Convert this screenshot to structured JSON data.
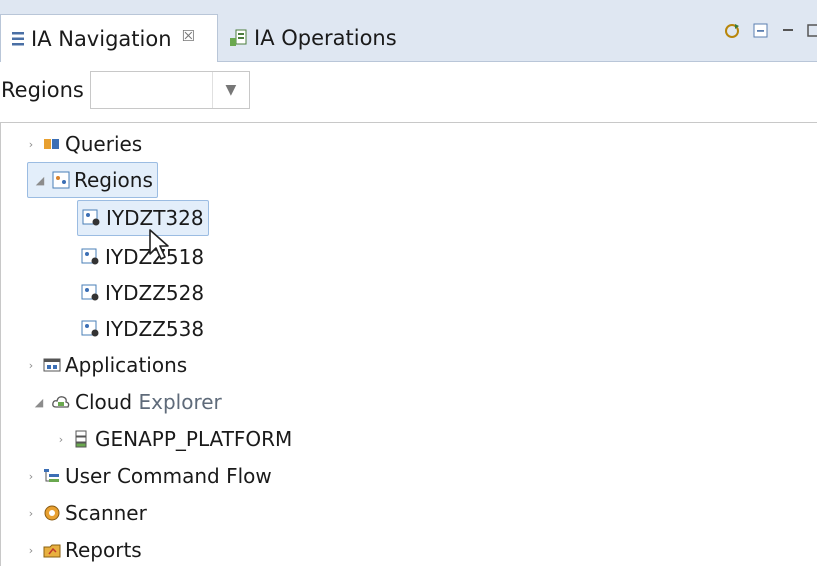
{
  "tabs": [
    {
      "label": "IA Navigation",
      "close": "☒",
      "icon": "navigation-list-icon"
    },
    {
      "label": "IA Operations",
      "icon": "operations-icon"
    }
  ],
  "filter": {
    "label": "Regions",
    "value": "",
    "dropdown_icon": "chevron-down-icon"
  },
  "tree": {
    "queries": "Queries",
    "regions": "Regions",
    "region_items": [
      "IYDZT328",
      "IYDZZ518",
      "IYDZZ528",
      "IYDZZ538"
    ],
    "applications": "Applications",
    "cloud_explorer": {
      "part1": "Cloud",
      "part2": "Explorer"
    },
    "genapp": "GENAPP_PLATFORM",
    "user_command_flow": "User Command Flow",
    "scanner": "Scanner",
    "reports": "Reports"
  },
  "colors": {
    "tab_bar": "#dfe7f2",
    "selection": "#e3eefa",
    "selection_border": "#9bbce2"
  }
}
